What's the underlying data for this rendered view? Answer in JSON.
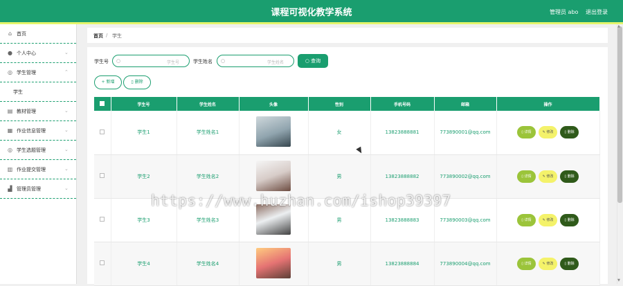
{
  "header": {
    "title": "课程可视化教学系统",
    "user_label": "管理员 abo",
    "logout_label": "退出登录"
  },
  "sidebar": {
    "items": [
      {
        "label": "首页",
        "icon": "home-icon",
        "has_chevron": false
      },
      {
        "label": "个人中心",
        "icon": "user-icon",
        "has_chevron": true
      },
      {
        "label": "学生管理",
        "icon": "compass-icon",
        "has_chevron": true,
        "expanded": true
      },
      {
        "label": "学生",
        "sub": true
      },
      {
        "label": "教材管理",
        "icon": "book-icon",
        "has_chevron": true
      },
      {
        "label": "作业信息管理",
        "icon": "briefcase-icon",
        "has_chevron": true
      },
      {
        "label": "学生选题管理",
        "icon": "compass-icon",
        "has_chevron": true
      },
      {
        "label": "作业提交管理",
        "icon": "printer-icon",
        "has_chevron": true
      },
      {
        "label": "管理员管理",
        "icon": "chart-icon",
        "has_chevron": true
      }
    ]
  },
  "breadcrumb": {
    "home": "首页",
    "separator": "/",
    "current": "学生"
  },
  "search": {
    "student_no_label": "学生号",
    "student_no_placeholder": "学生号",
    "student_name_label": "学生姓名",
    "student_name_placeholder": "学生姓名",
    "query_label": "查询",
    "add_label": "新增",
    "delete_label": "删除"
  },
  "table": {
    "headers": [
      "学生号",
      "学生姓名",
      "头像",
      "性别",
      "手机号码",
      "邮箱",
      "操作"
    ],
    "action_labels": {
      "detail": "详情",
      "edit": "修改",
      "delete": "删除"
    },
    "rows": [
      {
        "student_no": "学生1",
        "name": "学生姓名1",
        "gender": "女",
        "phone": "13823888881",
        "email": "773890001@qq.com"
      },
      {
        "student_no": "学生2",
        "name": "学生姓名2",
        "gender": "男",
        "phone": "13823888882",
        "email": "773890002@qq.com"
      },
      {
        "student_no": "学生3",
        "name": "学生姓名3",
        "gender": "男",
        "phone": "13823888883",
        "email": "773890003@qq.com"
      },
      {
        "student_no": "学生4",
        "name": "学生姓名4",
        "gender": "男",
        "phone": "13823888884",
        "email": "773890004@qq.com"
      }
    ]
  },
  "watermark": "https://www.huzhan.com/ishop39397",
  "colors": {
    "primary": "#1a9e6f",
    "accent": "#e4f56b",
    "detail_button": "#9bc43a",
    "edit_button": "#f4f26a",
    "delete_button": "#2f5a1a"
  }
}
